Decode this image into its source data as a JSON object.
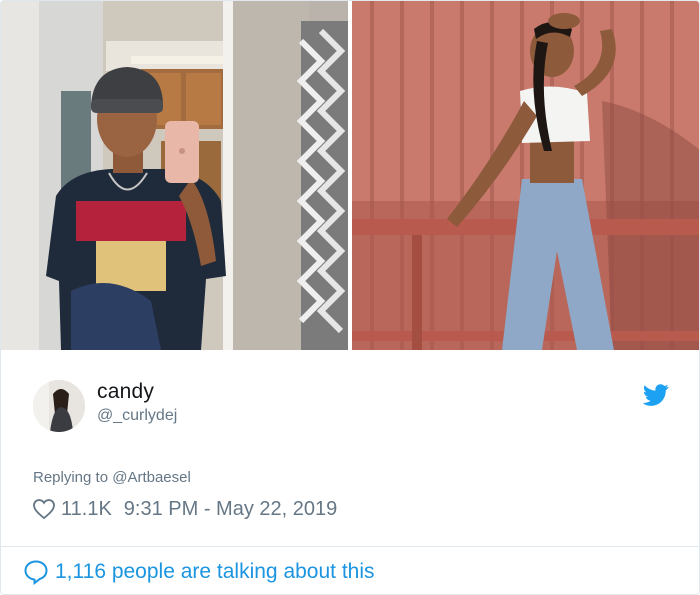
{
  "tweet": {
    "display_name": "candy",
    "handle": "@_curlydej",
    "replying_prefix": "Replying to",
    "replying_to": "@Artbaesel",
    "likes": "11.1K",
    "timestamp": "9:31 PM - May 22, 2019",
    "discussion": "1,116 people are talking about this"
  },
  "icons": {
    "like": "heart-outline-icon",
    "brand": "twitter-bird-icon",
    "comment": "speech-bubble-icon"
  },
  "colors": {
    "twitter_blue": "#1da1f2",
    "link_blue": "#1b95e0",
    "muted_text": "#657786",
    "primary_text": "#14171a",
    "border": "#e1e8ed"
  }
}
